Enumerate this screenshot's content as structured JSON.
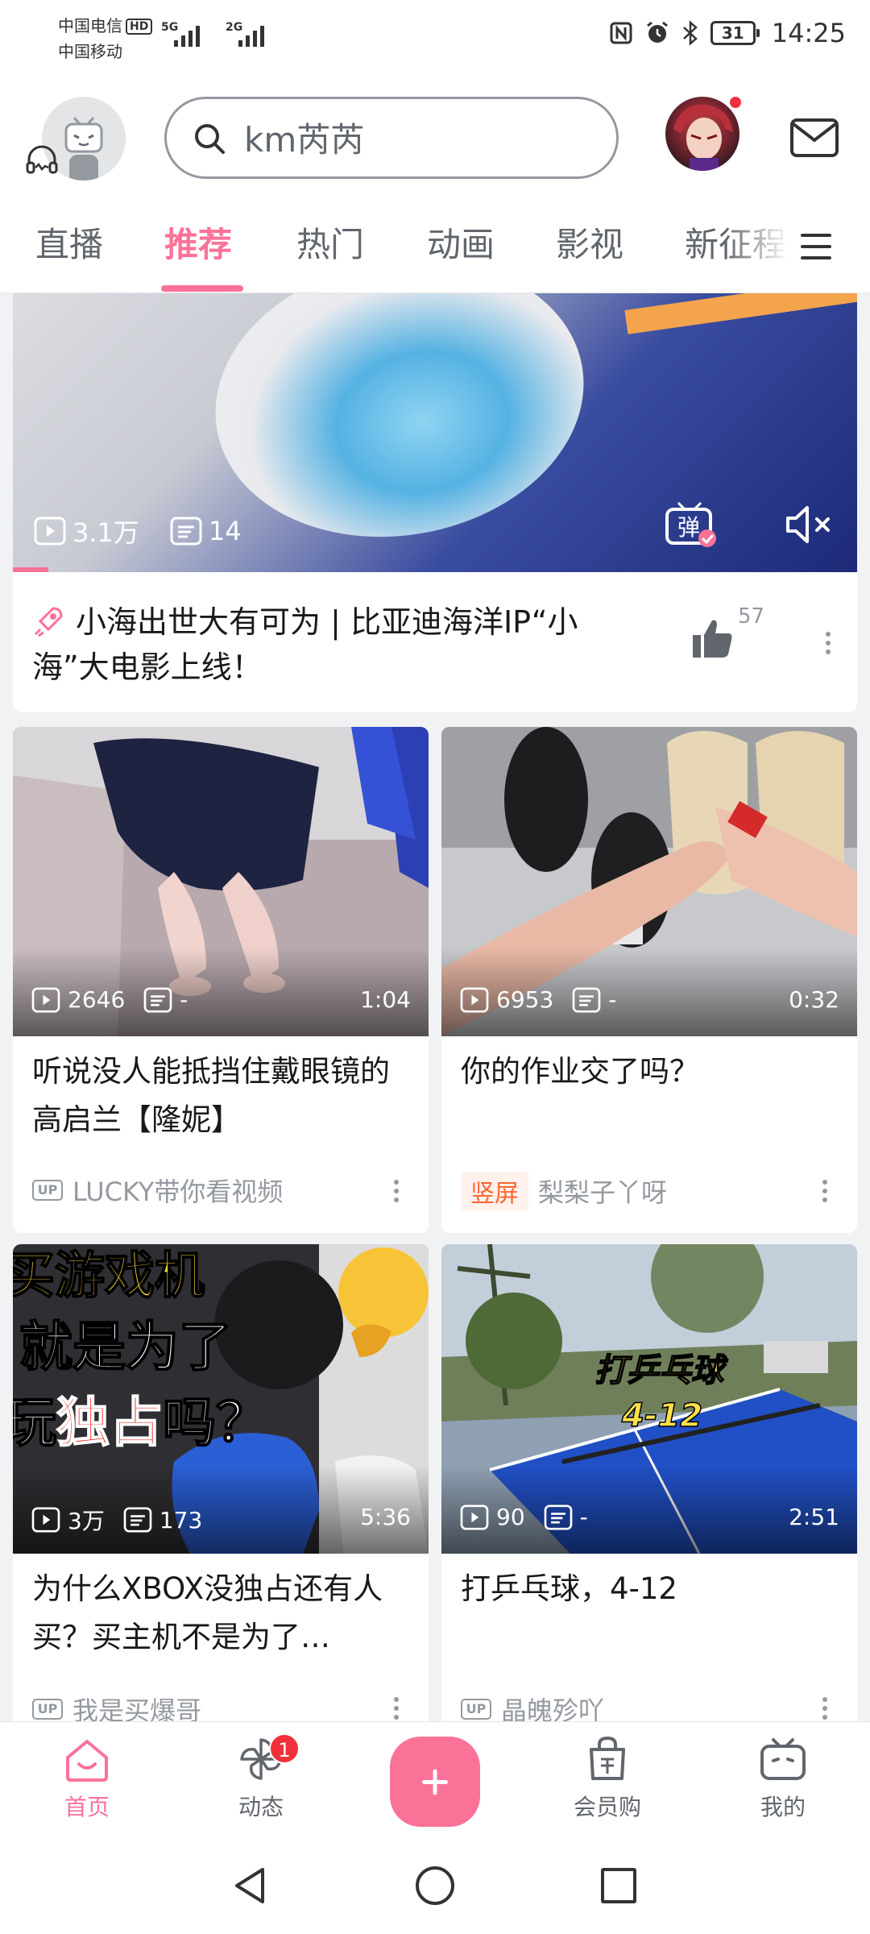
{
  "status_bar": {
    "carrier1": "中国电信",
    "hd_badge": "HD",
    "carrier2": "中国移动",
    "sim1_network": "5G",
    "sim2_network": "2G",
    "battery": "31",
    "time": "14:25"
  },
  "header": {
    "search_text": "km芮芮"
  },
  "tabs": [
    "直播",
    "推荐",
    "热门",
    "动画",
    "影视",
    "新征程"
  ],
  "active_tab": "推荐",
  "feature": {
    "views": "3.1万",
    "danmaku": "14",
    "title": "小海出世大有可为 | 比亚迪海洋IP“小海”大电影上线！",
    "likes": "57",
    "danmaku_button_label": "弹"
  },
  "cards": [
    {
      "views": "2646",
      "danmaku": "-",
      "duration": "1:04",
      "title": "听说没人能抵挡住戴眼镜的高启兰【隆妮】",
      "badge": "UP",
      "owner": "LUCKY带你看视频"
    },
    {
      "views": "6953",
      "danmaku": "-",
      "duration": "0:32",
      "title": "你的作业交了吗？",
      "tag": "竖屏",
      "owner": "梨梨子丫呀"
    },
    {
      "views": "3万",
      "danmaku": "173",
      "duration": "5:36",
      "title": "为什么XBOX没独占还有人买？买主机不是为了…",
      "badge": "UP",
      "owner": "我是买爆哥",
      "thumb_text": {
        "line1": "买游戏机",
        "line2": "就是为了",
        "line3_a": "玩",
        "line3_b": "独占",
        "line3_c": "吗？"
      }
    },
    {
      "views": "90",
      "danmaku": "-",
      "duration": "2:51",
      "title": "打乒乓球，4-12",
      "badge": "UP",
      "owner": "晶魄殄吖",
      "thumb_text": {
        "line1": "打乒乓球",
        "line2": "4-12"
      }
    }
  ],
  "bottom_nav": {
    "home": "首页",
    "dynamic": "动态",
    "dynamic_badge": "1",
    "vip_shop": "会员购",
    "mine": "我的"
  },
  "colors": {
    "accent": "#fb7299",
    "text": "#18191c",
    "secondary": "#9499a0"
  }
}
